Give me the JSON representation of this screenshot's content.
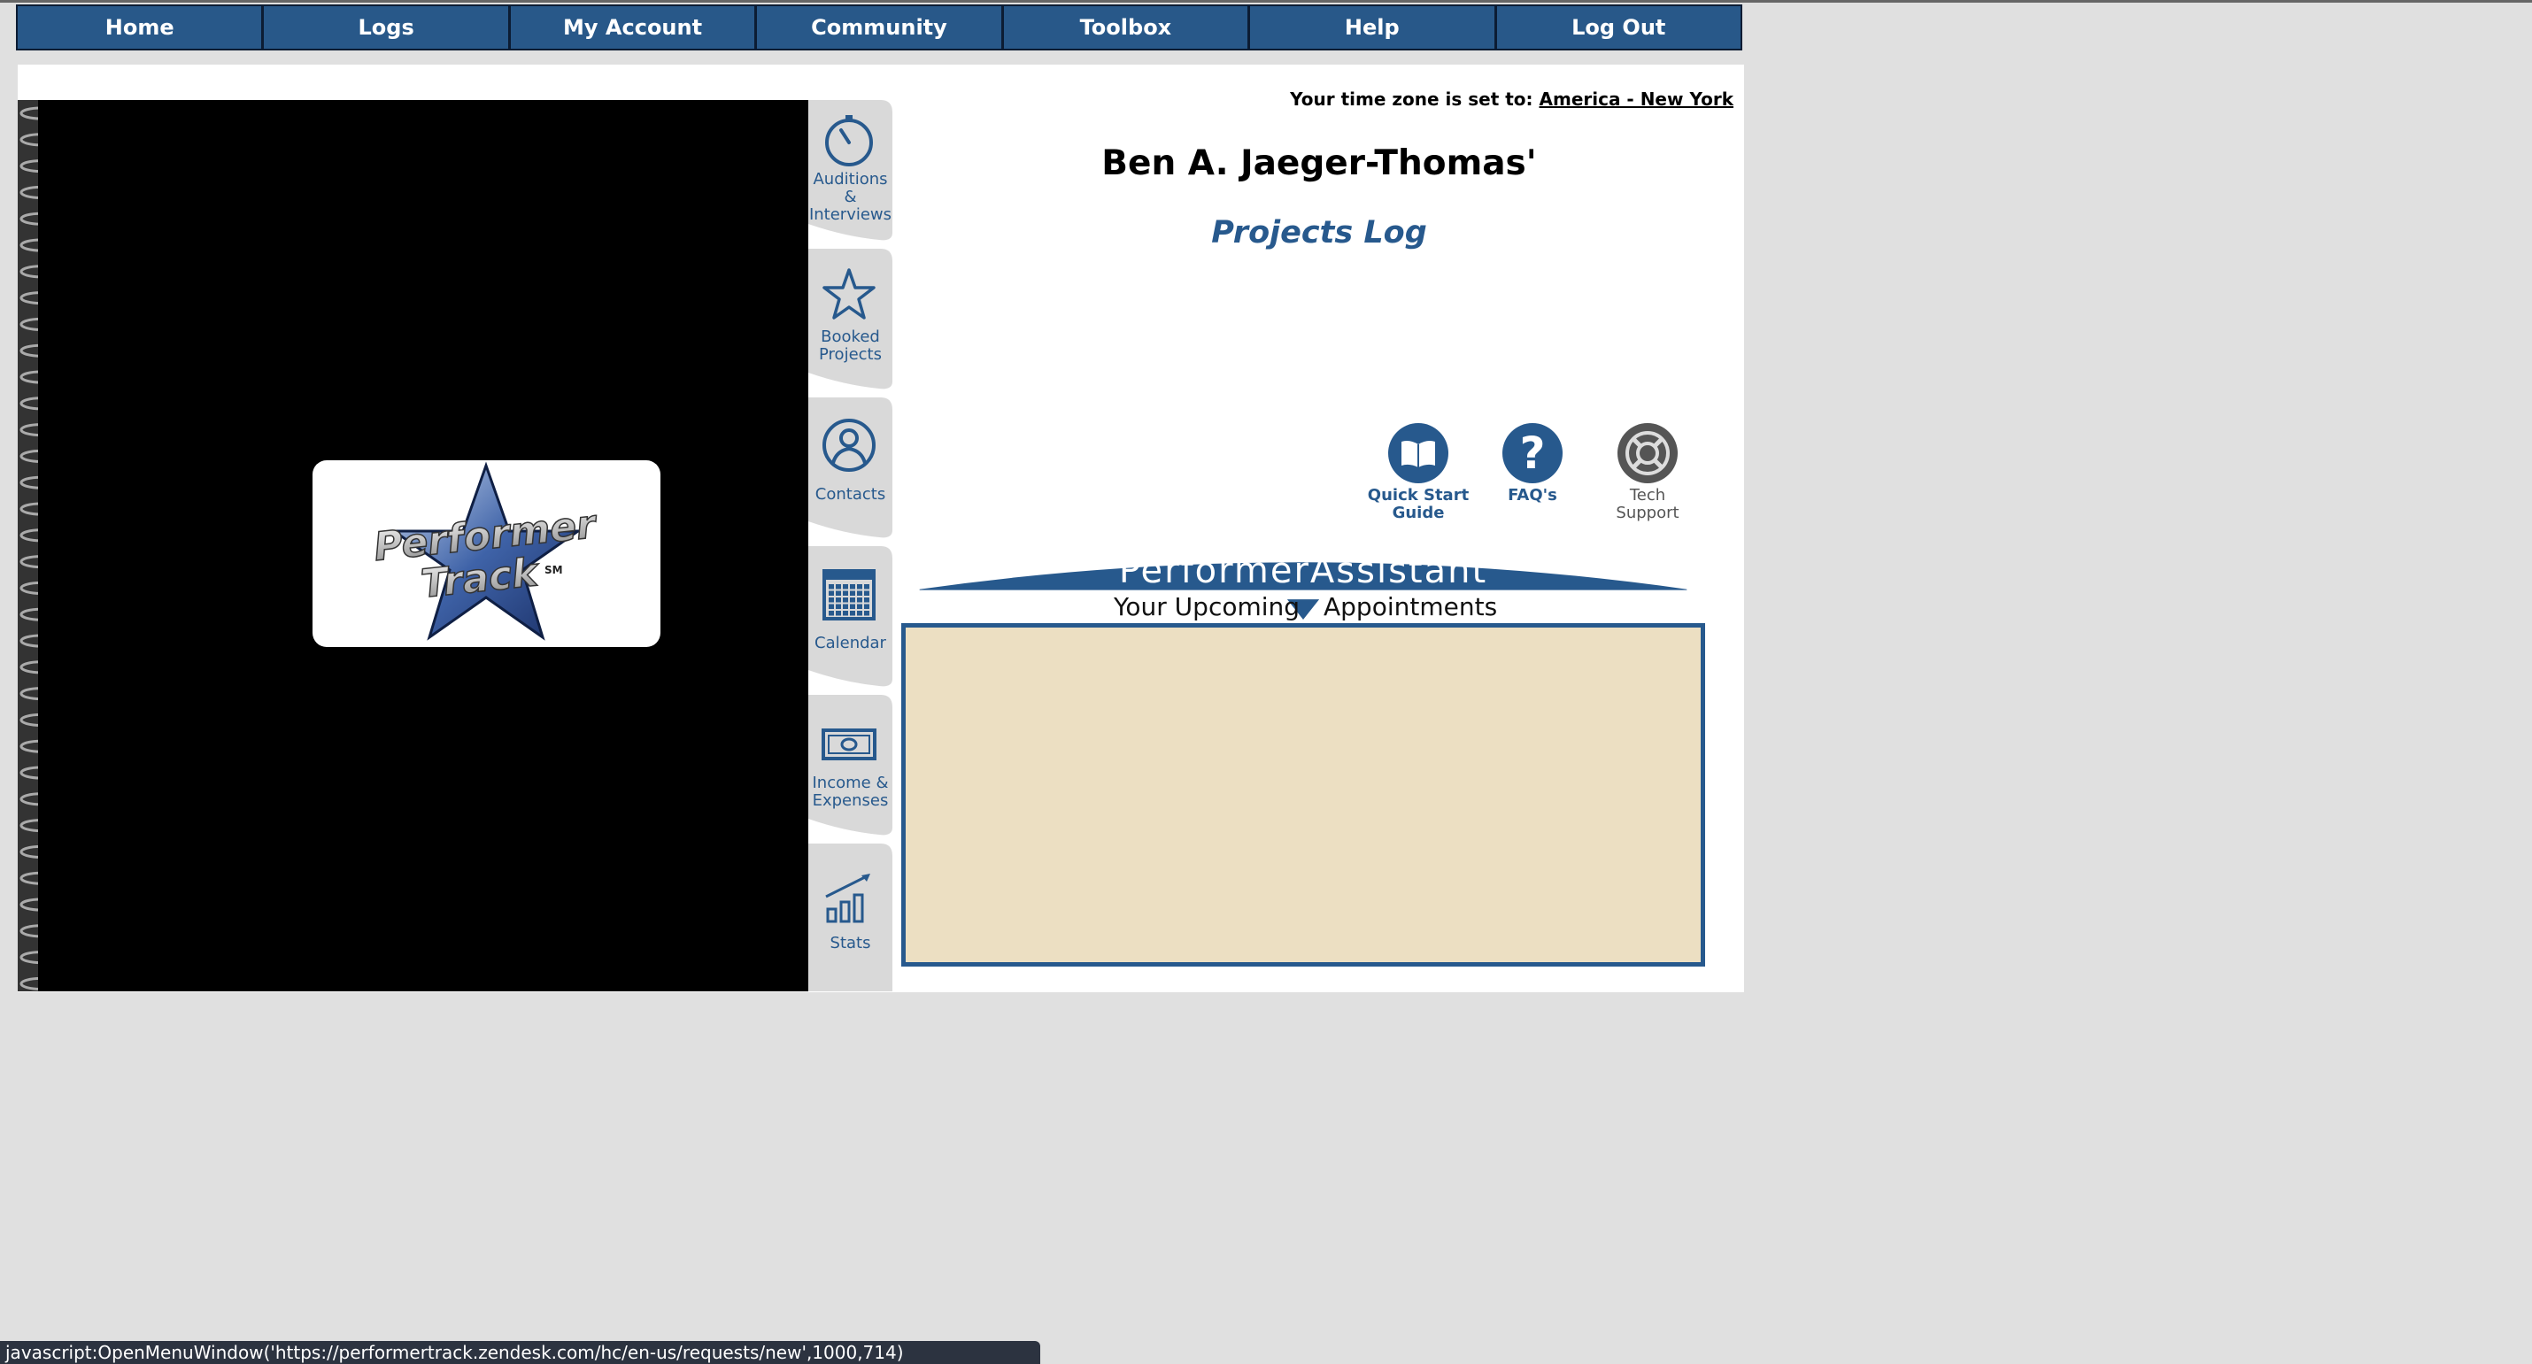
{
  "nav": {
    "items": [
      {
        "label": "Home"
      },
      {
        "label": "Logs"
      },
      {
        "label": "My Account"
      },
      {
        "label": "Community"
      },
      {
        "label": "Toolbox"
      },
      {
        "label": "Help"
      },
      {
        "label": "Log Out"
      }
    ]
  },
  "logo": {
    "text_line1": "Performer",
    "text_line2": "Track",
    "mark": "SM"
  },
  "tabs": [
    {
      "lines": [
        "Auditions",
        "&",
        "Interviews"
      ],
      "icon": "stopwatch-icon"
    },
    {
      "lines": [
        "Booked",
        "Projects"
      ],
      "icon": "star-icon"
    },
    {
      "lines": [
        "Contacts"
      ],
      "icon": "person-icon"
    },
    {
      "lines": [
        "Calendar"
      ],
      "icon": "calendar-icon"
    },
    {
      "lines": [
        "Income &",
        "Expenses"
      ],
      "icon": "money-icon"
    },
    {
      "lines": [
        "Stats"
      ],
      "icon": "bar-chart-icon"
    }
  ],
  "timezone": {
    "prefix": "Your time zone is set to:",
    "value": "America - New York"
  },
  "owner_title": "Ben A. Jaeger-Thomas'",
  "log_title": "Projects Log",
  "help_links": [
    {
      "lines": [
        "Quick Start",
        "Guide"
      ],
      "icon": "book-icon",
      "color": "#27598d"
    },
    {
      "lines": [
        "FAQ's"
      ],
      "icon": "question-icon",
      "color": "#27598d"
    },
    {
      "lines": [
        "Tech",
        "Support"
      ],
      "icon": "lifebuoy-icon",
      "color": "#555555"
    }
  ],
  "assistant": {
    "title": "PerformerAssistant",
    "subtitle_left": "Your Upcoming",
    "subtitle_right": "Appointments"
  },
  "status_bar": "javascript:OpenMenuWindow('https://performertrack.zendesk.com/hc/en-us/requests/new',1000,714)",
  "colors": {
    "nav_blue": "#285889",
    "accent_blue": "#27598d",
    "appointment_bg": "#ecdfc2",
    "page_bg": "#e0e0e0"
  }
}
